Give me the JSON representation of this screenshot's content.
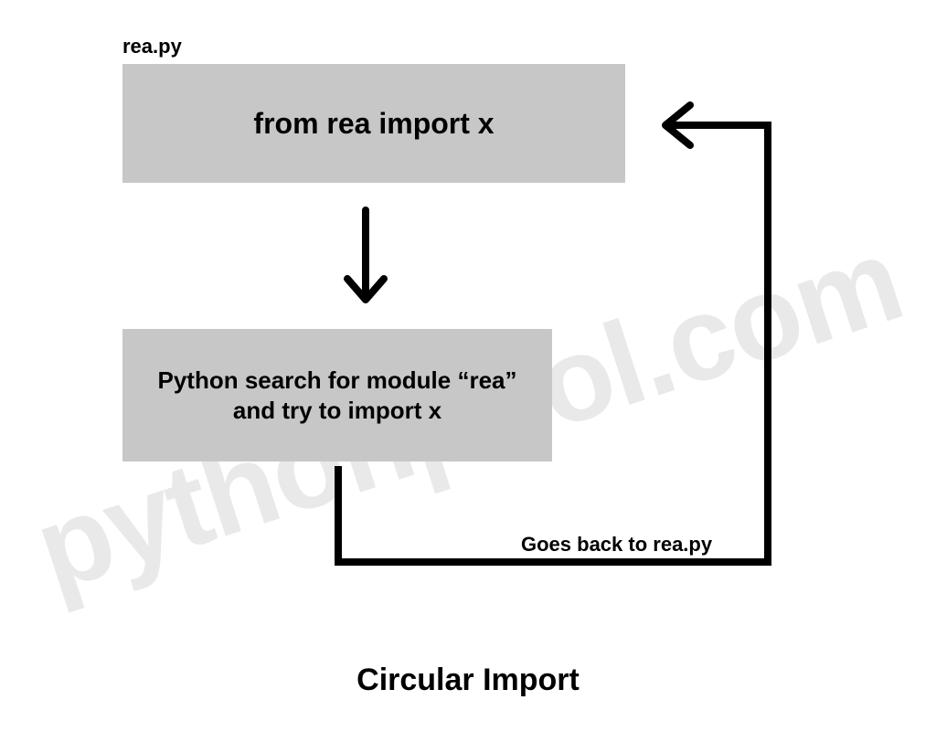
{
  "file_label": "rea.py",
  "box_top_text": "from rea import x",
  "box_bottom_text": "Python search for module “rea” and try to import x",
  "goes_back_label": "Goes back to rea.py",
  "title": "Circular Import",
  "watermark": "pythonpool.com"
}
